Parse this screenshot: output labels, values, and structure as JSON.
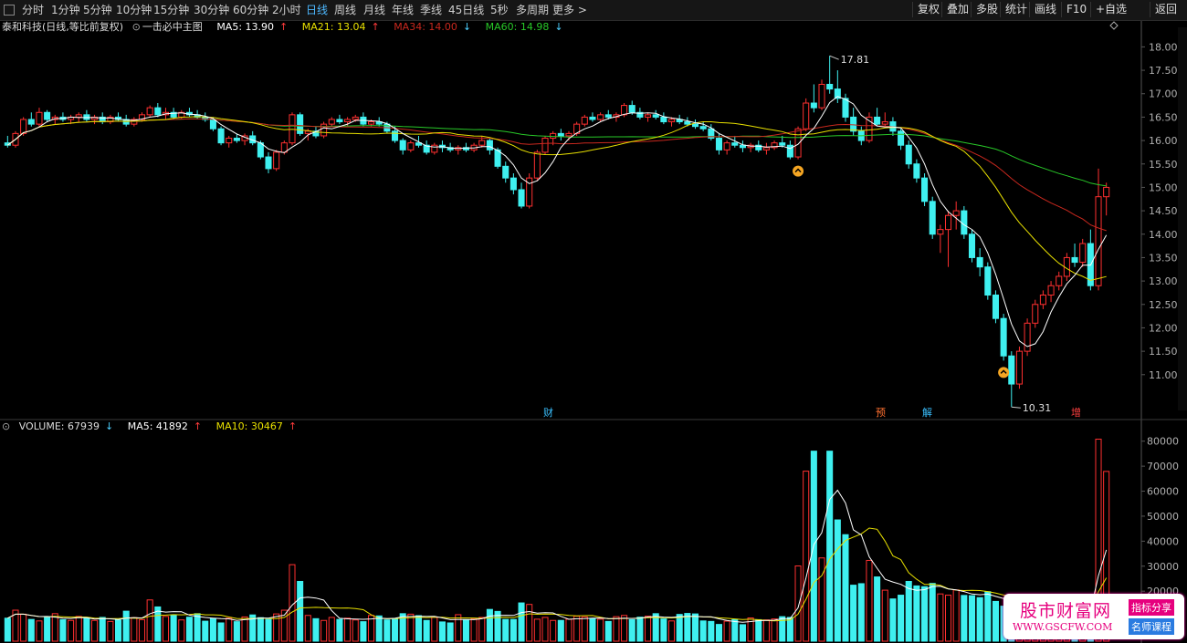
{
  "toolbar": {
    "periods": [
      "分时",
      "1分钟",
      "5分钟",
      "10分钟",
      "15分钟",
      "30分钟",
      "60分钟",
      "2小时",
      "日线",
      "周线",
      "月线",
      "年线",
      "季线",
      "45日线",
      "5秒",
      "多周期",
      "更多 >"
    ],
    "active": "日线",
    "right_buttons": [
      "复权",
      "叠加",
      "多股",
      "统计",
      "画线",
      "F10",
      "+自选",
      "返回"
    ]
  },
  "main_legend": {
    "title": "泰和科技(日线,等比前复权)",
    "indicator": "一击必中主图",
    "ma5": "MA5: 13.90",
    "ma21": "MA21: 13.04",
    "ma34": "MA34: 14.00",
    "ma60": "MA60: 14.98",
    "arrows": {
      "ma5": "↑",
      "ma21": "↑",
      "ma34": "↓",
      "ma60": "↓"
    }
  },
  "vol_legend": {
    "volume": "VOLUME: 67939",
    "ma5": "MA5: 41892",
    "ma10": "MA10: 30467",
    "arrows": {
      "volume": "↓",
      "ma5": "↑",
      "ma10": "↑"
    }
  },
  "markers": {
    "high": "17.81",
    "low": "10.31",
    "events": [
      "财",
      "预",
      "解",
      "增"
    ]
  },
  "colors": {
    "up": "#ff3030",
    "down": "#3ff0f0",
    "ma5": "#ffffff",
    "ma21": "#e8e000",
    "ma34": "#c8281e",
    "ma60": "#28c828",
    "axis": "#555555",
    "ticks": "#b0b0b0",
    "volma10": "#e8e000"
  },
  "watermark": {
    "title": "股市财富网",
    "url": "WWW.GSCFW.COM",
    "tag1": "指标分享",
    "tag2": "名师课程"
  },
  "chart_data": {
    "type": "candlestick",
    "price_ticks": [
      "18.00",
      "17.50",
      "17.00",
      "16.50",
      "16.00",
      "15.50",
      "15.00",
      "14.50",
      "14.00",
      "13.50",
      "13.00",
      "12.50",
      "12.00",
      "11.50",
      "11.00"
    ],
    "price_range": [
      10.1,
      18.3
    ],
    "volume_ticks": [
      "80000",
      "70000",
      "60000",
      "50000",
      "40000",
      "30000",
      "20000"
    ],
    "volume_range": [
      0,
      85000
    ],
    "ohlc": [
      [
        15.95,
        16.1,
        15.85,
        15.9
      ],
      [
        15.9,
        16.2,
        15.85,
        16.15
      ],
      [
        16.15,
        16.5,
        16.1,
        16.45
      ],
      [
        16.45,
        16.6,
        16.3,
        16.35
      ],
      [
        16.35,
        16.7,
        16.3,
        16.6
      ],
      [
        16.6,
        16.65,
        16.4,
        16.45
      ],
      [
        16.45,
        16.55,
        16.35,
        16.5
      ],
      [
        16.5,
        16.6,
        16.4,
        16.45
      ],
      [
        16.45,
        16.55,
        16.35,
        16.5
      ],
      [
        16.5,
        16.6,
        16.4,
        16.55
      ],
      [
        16.55,
        16.65,
        16.4,
        16.45
      ],
      [
        16.45,
        16.55,
        16.35,
        16.5
      ],
      [
        16.5,
        16.6,
        16.35,
        16.4
      ],
      [
        16.4,
        16.55,
        16.35,
        16.5
      ],
      [
        16.5,
        16.6,
        16.4,
        16.45
      ],
      [
        16.45,
        16.55,
        16.3,
        16.35
      ],
      [
        16.35,
        16.5,
        16.3,
        16.45
      ],
      [
        16.45,
        16.6,
        16.4,
        16.55
      ],
      [
        16.55,
        16.75,
        16.5,
        16.7
      ],
      [
        16.7,
        16.8,
        16.5,
        16.55
      ],
      [
        16.55,
        16.7,
        16.45,
        16.6
      ],
      [
        16.6,
        16.7,
        16.45,
        16.5
      ],
      [
        16.5,
        16.65,
        16.45,
        16.6
      ],
      [
        16.6,
        16.7,
        16.5,
        16.55
      ],
      [
        16.55,
        16.65,
        16.45,
        16.5
      ],
      [
        16.5,
        16.6,
        16.4,
        16.45
      ],
      [
        16.45,
        16.5,
        16.2,
        16.25
      ],
      [
        16.25,
        16.3,
        15.9,
        15.95
      ],
      [
        15.95,
        16.1,
        15.85,
        16.05
      ],
      [
        16.05,
        16.15,
        15.95,
        16.0
      ],
      [
        16.0,
        16.15,
        15.9,
        16.1
      ],
      [
        16.1,
        16.2,
        15.9,
        15.95
      ],
      [
        15.95,
        16.0,
        15.6,
        15.65
      ],
      [
        15.65,
        15.75,
        15.3,
        15.4
      ],
      [
        15.4,
        15.8,
        15.35,
        15.75
      ],
      [
        15.75,
        16.0,
        15.7,
        15.95
      ],
      [
        15.95,
        16.6,
        15.9,
        16.55
      ],
      [
        16.55,
        16.6,
        16.1,
        16.15
      ],
      [
        16.15,
        16.25,
        16.0,
        16.2
      ],
      [
        16.2,
        16.3,
        16.05,
        16.1
      ],
      [
        16.1,
        16.4,
        16.05,
        16.35
      ],
      [
        16.35,
        16.5,
        16.3,
        16.45
      ],
      [
        16.45,
        16.55,
        16.35,
        16.4
      ],
      [
        16.4,
        16.5,
        16.3,
        16.45
      ],
      [
        16.45,
        16.55,
        16.4,
        16.5
      ],
      [
        16.5,
        16.6,
        16.3,
        16.35
      ],
      [
        16.35,
        16.45,
        16.3,
        16.4
      ],
      [
        16.4,
        16.5,
        16.3,
        16.35
      ],
      [
        16.35,
        16.4,
        16.15,
        16.2
      ],
      [
        16.2,
        16.3,
        15.95,
        16.0
      ],
      [
        16.0,
        16.05,
        15.7,
        15.8
      ],
      [
        15.8,
        16.0,
        15.75,
        15.95
      ],
      [
        15.95,
        16.1,
        15.85,
        15.9
      ],
      [
        15.9,
        16.0,
        15.7,
        15.75
      ],
      [
        15.75,
        15.95,
        15.7,
        15.9
      ],
      [
        15.9,
        16.0,
        15.75,
        15.85
      ],
      [
        15.85,
        15.95,
        15.75,
        15.8
      ],
      [
        15.8,
        15.9,
        15.7,
        15.85
      ],
      [
        15.85,
        15.95,
        15.75,
        15.8
      ],
      [
        15.8,
        15.95,
        15.75,
        15.9
      ],
      [
        15.9,
        16.1,
        15.85,
        16.0
      ],
      [
        16.0,
        16.05,
        15.7,
        15.8
      ],
      [
        15.8,
        15.85,
        15.4,
        15.45
      ],
      [
        15.45,
        15.55,
        15.1,
        15.2
      ],
      [
        15.2,
        15.3,
        14.85,
        14.95
      ],
      [
        14.95,
        15.1,
        14.55,
        14.6
      ],
      [
        14.6,
        15.3,
        14.55,
        15.2
      ],
      [
        15.2,
        15.8,
        15.15,
        15.75
      ],
      [
        15.75,
        16.1,
        15.7,
        16.05
      ],
      [
        16.05,
        16.2,
        15.9,
        16.15
      ],
      [
        16.15,
        16.25,
        16.0,
        16.1
      ],
      [
        16.1,
        16.2,
        16.0,
        16.15
      ],
      [
        16.15,
        16.4,
        16.1,
        16.35
      ],
      [
        16.35,
        16.55,
        16.3,
        16.5
      ],
      [
        16.5,
        16.6,
        16.4,
        16.45
      ],
      [
        16.45,
        16.6,
        16.4,
        16.55
      ],
      [
        16.55,
        16.65,
        16.45,
        16.5
      ],
      [
        16.5,
        16.6,
        16.4,
        16.55
      ],
      [
        16.55,
        16.8,
        16.5,
        16.75
      ],
      [
        16.75,
        16.85,
        16.55,
        16.6
      ],
      [
        16.6,
        16.7,
        16.45,
        16.5
      ],
      [
        16.5,
        16.6,
        16.4,
        16.55
      ],
      [
        16.55,
        16.65,
        16.45,
        16.5
      ],
      [
        16.5,
        16.6,
        16.35,
        16.4
      ],
      [
        16.4,
        16.5,
        16.3,
        16.45
      ],
      [
        16.45,
        16.55,
        16.35,
        16.4
      ],
      [
        16.4,
        16.5,
        16.3,
        16.35
      ],
      [
        16.35,
        16.45,
        16.25,
        16.3
      ],
      [
        16.3,
        16.4,
        16.2,
        16.25
      ],
      [
        16.25,
        16.35,
        16.0,
        16.05
      ],
      [
        16.05,
        16.15,
        15.7,
        15.8
      ],
      [
        15.8,
        16.0,
        15.7,
        15.95
      ],
      [
        15.95,
        16.1,
        15.85,
        15.9
      ],
      [
        15.9,
        16.0,
        15.75,
        15.85
      ],
      [
        15.85,
        15.95,
        15.75,
        15.9
      ],
      [
        15.9,
        16.0,
        15.75,
        15.8
      ],
      [
        15.8,
        15.95,
        15.7,
        15.85
      ],
      [
        15.85,
        16.0,
        15.8,
        15.95
      ],
      [
        15.95,
        16.1,
        15.85,
        15.9
      ],
      [
        15.9,
        16.0,
        15.6,
        15.65
      ],
      [
        15.65,
        16.3,
        15.6,
        16.25
      ],
      [
        16.25,
        16.9,
        16.2,
        16.8
      ],
      [
        16.8,
        17.2,
        16.6,
        16.7
      ],
      [
        16.7,
        17.3,
        16.65,
        17.2
      ],
      [
        17.2,
        17.81,
        17.0,
        17.1
      ],
      [
        17.1,
        17.5,
        16.8,
        16.9
      ],
      [
        16.9,
        17.0,
        16.4,
        16.5
      ],
      [
        16.5,
        16.7,
        16.1,
        16.2
      ],
      [
        16.2,
        16.3,
        15.9,
        16.0
      ],
      [
        16.0,
        16.6,
        15.95,
        16.5
      ],
      [
        16.5,
        16.7,
        16.3,
        16.35
      ],
      [
        16.35,
        16.6,
        16.3,
        16.4
      ],
      [
        16.4,
        16.5,
        16.1,
        16.2
      ],
      [
        16.2,
        16.25,
        15.8,
        15.9
      ],
      [
        15.9,
        16.0,
        15.4,
        15.5
      ],
      [
        15.5,
        15.6,
        15.1,
        15.2
      ],
      [
        15.2,
        15.3,
        14.6,
        14.7
      ],
      [
        14.7,
        14.8,
        13.9,
        14.0
      ],
      [
        14.0,
        14.2,
        13.6,
        14.1
      ],
      [
        14.1,
        14.5,
        13.3,
        14.4
      ],
      [
        14.4,
        14.7,
        14.1,
        14.5
      ],
      [
        14.5,
        14.6,
        13.9,
        14.0
      ],
      [
        14.0,
        14.1,
        13.4,
        13.5
      ],
      [
        13.5,
        13.7,
        13.1,
        13.3
      ],
      [
        13.3,
        13.4,
        12.6,
        12.7
      ],
      [
        12.7,
        12.8,
        12.1,
        12.2
      ],
      [
        12.2,
        12.3,
        11.3,
        11.4
      ],
      [
        11.4,
        11.5,
        10.31,
        10.8
      ],
      [
        10.8,
        11.6,
        10.7,
        11.5
      ],
      [
        11.5,
        12.2,
        11.4,
        12.1
      ],
      [
        12.1,
        12.6,
        12.0,
        12.5
      ],
      [
        12.5,
        12.8,
        12.4,
        12.7
      ],
      [
        12.7,
        13.0,
        12.55,
        12.9
      ],
      [
        12.9,
        13.2,
        12.8,
        13.1
      ],
      [
        13.1,
        13.6,
        13.0,
        13.5
      ],
      [
        13.5,
        13.8,
        13.3,
        13.4
      ],
      [
        13.4,
        13.9,
        13.3,
        13.8
      ],
      [
        13.8,
        14.1,
        12.8,
        12.9
      ],
      [
        12.9,
        15.4,
        12.8,
        14.8
      ],
      [
        14.8,
        15.1,
        14.4,
        15.0
      ]
    ],
    "volume": [
      9200,
      12400,
      10800,
      8700,
      8100,
      9500,
      11000,
      8600,
      8300,
      9900,
      9100,
      8300,
      9500,
      7900,
      8400,
      12000,
      9400,
      8600,
      16500,
      13700,
      9900,
      10400,
      8500,
      9600,
      11000,
      8000,
      9100,
      7300,
      9200,
      7800,
      9700,
      10500,
      9400,
      8700,
      10900,
      12400,
      30600,
      23900,
      10300,
      9000,
      8300,
      9500,
      8700,
      9200,
      8500,
      7800,
      10300,
      10100,
      8500,
      9100,
      11000,
      10800,
      10200,
      8300,
      9500,
      7700,
      7300,
      10600,
      8400,
      9000,
      9500,
      12700,
      11900,
      8700,
      8700,
      15300,
      14700,
      8800,
      9500,
      8300,
      8300,
      8800,
      10000,
      9700,
      9100,
      8800,
      7900,
      9800,
      10300,
      8600,
      9600,
      10000,
      11000,
      8900,
      8100,
      10700,
      11100,
      10900,
      8100,
      7900,
      6700,
      8000,
      8600,
      6600,
      9300,
      8600,
      8500,
      8900,
      9800,
      9500,
      30100,
      68000,
      76000,
      33300,
      76000,
      48500,
      42600,
      22400,
      23000,
      32300,
      25700,
      20400,
      16900,
      18400,
      23900,
      22100,
      21800,
      23100,
      18900,
      18400,
      20500,
      18300,
      18200,
      17400,
      19800,
      15900,
      14000,
      17000,
      14200,
      11500,
      16800,
      14700,
      12100,
      11100,
      16300,
      12200,
      9600,
      12100,
      80800,
      67900
    ],
    "up_events": [
      100,
      126
    ]
  }
}
